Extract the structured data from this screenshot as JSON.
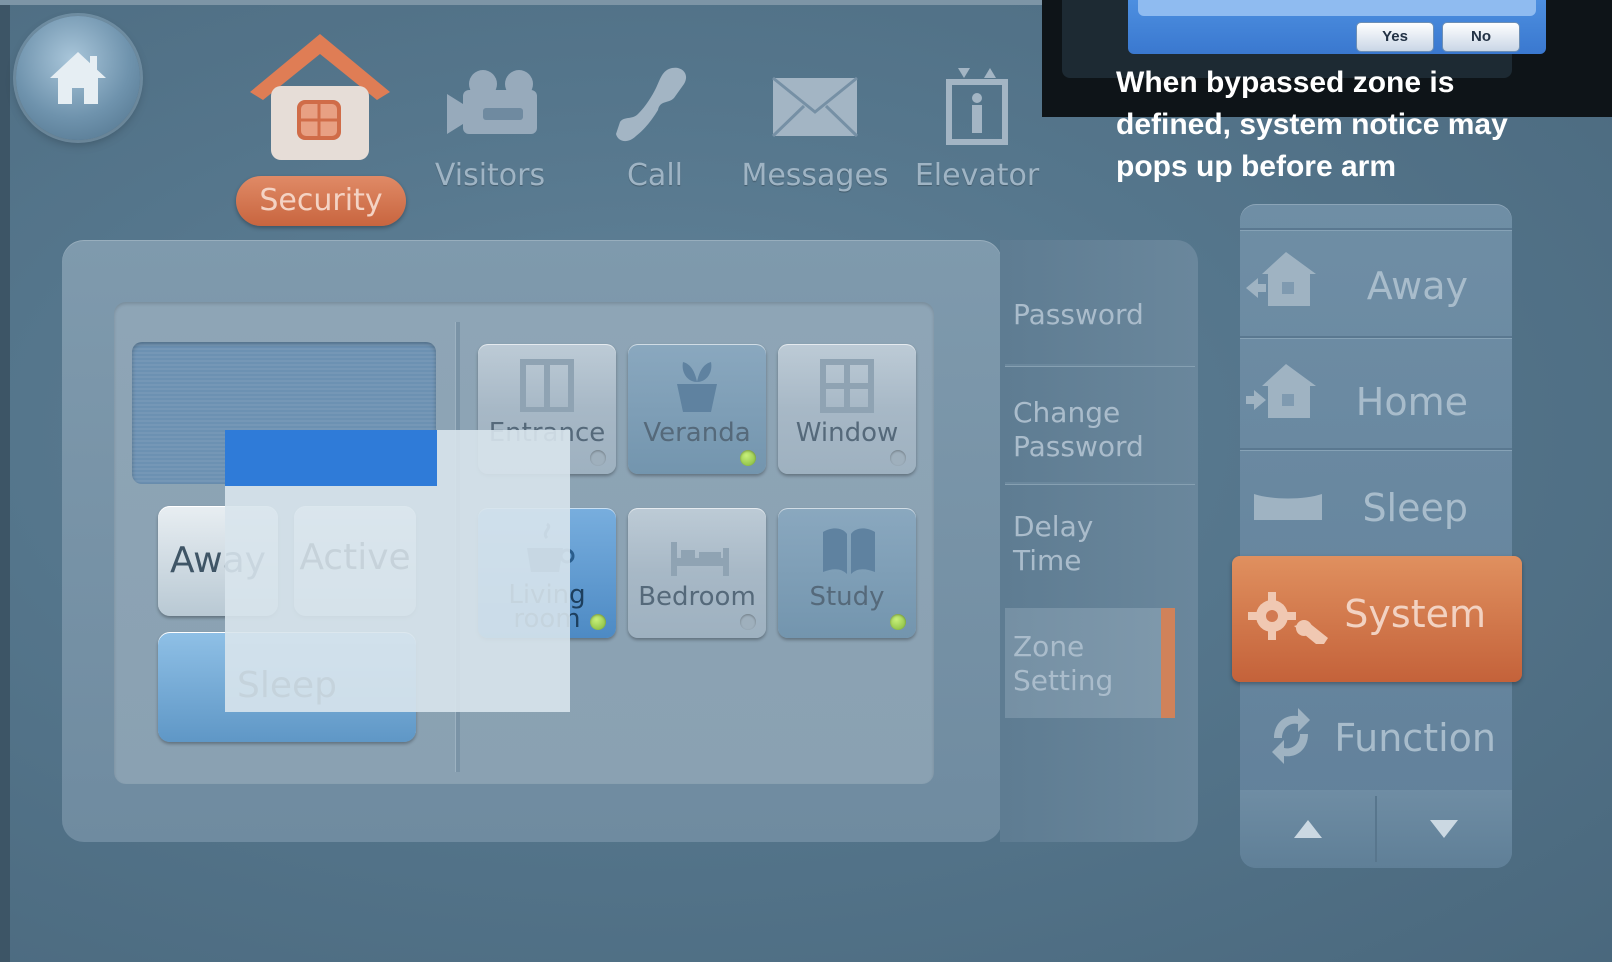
{
  "top_nav": {
    "items": [
      {
        "label": "Security",
        "icon": "house-icon",
        "selected": true
      },
      {
        "label": "Visitors",
        "icon": "camera-icon"
      },
      {
        "label": "Call",
        "icon": "phone-icon"
      },
      {
        "label": "Messages",
        "icon": "envelope-icon"
      },
      {
        "label": "Elevator",
        "icon": "elevator-icon"
      }
    ]
  },
  "notice": {
    "yes_label": "Yes",
    "no_label": "No",
    "text": "When bypassed zone is defined, system notice may pops up before arm"
  },
  "mode_buttons": {
    "away": "Away",
    "active": "Active",
    "sleep": "Sleep"
  },
  "zones": [
    {
      "label": "Entrance",
      "icon": "door-icon",
      "led": "off"
    },
    {
      "label": "Veranda",
      "icon": "plant-icon",
      "led": "green"
    },
    {
      "label": "Window",
      "icon": "window-icon",
      "led": "off"
    },
    {
      "label_line1": "Living",
      "label_line2": "room",
      "icon": "teacup-icon",
      "led": "green"
    },
    {
      "label": "Bedroom",
      "icon": "bed-icon",
      "led": "off"
    },
    {
      "label": "Study",
      "icon": "book-icon",
      "led": "green"
    }
  ],
  "settings_menu": {
    "password": "Password",
    "change_password_1": "Change",
    "change_password_2": "Password",
    "delay_time_1": "Delay",
    "delay_time_2": "Time",
    "zone_setting_1": "Zone",
    "zone_setting_2": "Setting"
  },
  "right_menu": {
    "away": "Away",
    "home": "Home",
    "sleep": "Sleep",
    "system": "System",
    "function": "Function",
    "up_icon": "triangle-up-icon",
    "down_icon": "triangle-down-icon"
  },
  "colors": {
    "accent_orange": "#c8653f",
    "led_green": "#7fb53a",
    "highlight_blue": "#2f7bd8"
  }
}
